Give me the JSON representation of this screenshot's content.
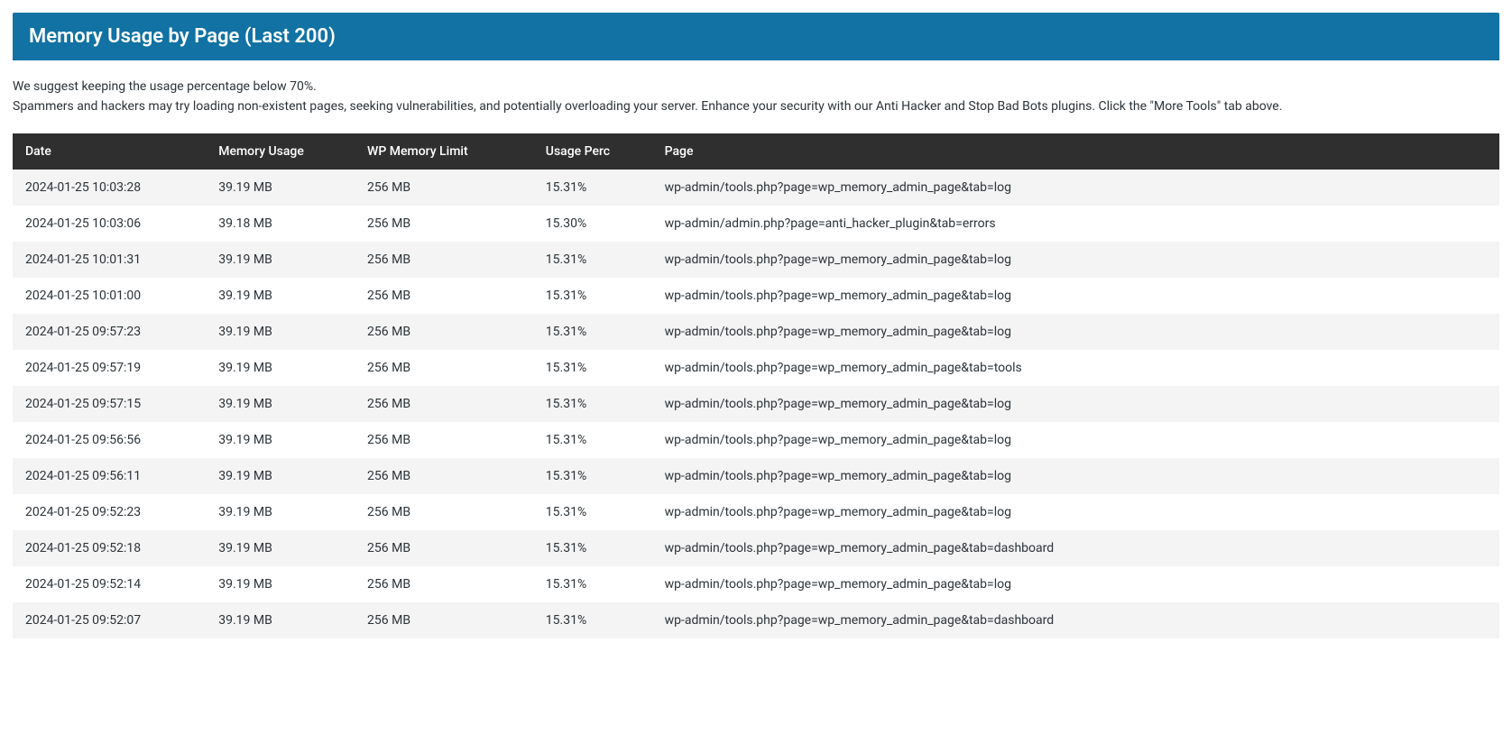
{
  "header": {
    "title": "Memory Usage by Page (Last 200)"
  },
  "description": {
    "line1": "We suggest keeping the usage percentage below 70%.",
    "line2": "Spammers and hackers may try loading non-existent pages, seeking vulnerabilities, and potentially overloading your server. Enhance your security with our Anti Hacker and Stop Bad Bots plugins. Click the \"More Tools\" tab above."
  },
  "table": {
    "columns": {
      "date": "Date",
      "memory": "Memory Usage",
      "limit": "WP Memory Limit",
      "perc": "Usage Perc",
      "page": "Page"
    },
    "rows": [
      {
        "date": "2024-01-25 10:03:28",
        "memory": "39.19 MB",
        "limit": "256 MB",
        "perc": "15.31%",
        "page": "wp-admin/tools.php?page=wp_memory_admin_page&tab=log"
      },
      {
        "date": "2024-01-25 10:03:06",
        "memory": "39.18 MB",
        "limit": "256 MB",
        "perc": "15.30%",
        "page": "wp-admin/admin.php?page=anti_hacker_plugin&tab=errors"
      },
      {
        "date": "2024-01-25 10:01:31",
        "memory": "39.19 MB",
        "limit": "256 MB",
        "perc": "15.31%",
        "page": "wp-admin/tools.php?page=wp_memory_admin_page&tab=log"
      },
      {
        "date": "2024-01-25 10:01:00",
        "memory": "39.19 MB",
        "limit": "256 MB",
        "perc": "15.31%",
        "page": "wp-admin/tools.php?page=wp_memory_admin_page&tab=log"
      },
      {
        "date": "2024-01-25 09:57:23",
        "memory": "39.19 MB",
        "limit": "256 MB",
        "perc": "15.31%",
        "page": "wp-admin/tools.php?page=wp_memory_admin_page&tab=log"
      },
      {
        "date": "2024-01-25 09:57:19",
        "memory": "39.19 MB",
        "limit": "256 MB",
        "perc": "15.31%",
        "page": "wp-admin/tools.php?page=wp_memory_admin_page&tab=tools"
      },
      {
        "date": "2024-01-25 09:57:15",
        "memory": "39.19 MB",
        "limit": "256 MB",
        "perc": "15.31%",
        "page": "wp-admin/tools.php?page=wp_memory_admin_page&tab=log"
      },
      {
        "date": "2024-01-25 09:56:56",
        "memory": "39.19 MB",
        "limit": "256 MB",
        "perc": "15.31%",
        "page": "wp-admin/tools.php?page=wp_memory_admin_page&tab=log"
      },
      {
        "date": "2024-01-25 09:56:11",
        "memory": "39.19 MB",
        "limit": "256 MB",
        "perc": "15.31%",
        "page": "wp-admin/tools.php?page=wp_memory_admin_page&tab=log"
      },
      {
        "date": "2024-01-25 09:52:23",
        "memory": "39.19 MB",
        "limit": "256 MB",
        "perc": "15.31%",
        "page": "wp-admin/tools.php?page=wp_memory_admin_page&tab=log"
      },
      {
        "date": "2024-01-25 09:52:18",
        "memory": "39.19 MB",
        "limit": "256 MB",
        "perc": "15.31%",
        "page": "wp-admin/tools.php?page=wp_memory_admin_page&tab=dashboard"
      },
      {
        "date": "2024-01-25 09:52:14",
        "memory": "39.19 MB",
        "limit": "256 MB",
        "perc": "15.31%",
        "page": "wp-admin/tools.php?page=wp_memory_admin_page&tab=log"
      },
      {
        "date": "2024-01-25 09:52:07",
        "memory": "39.19 MB",
        "limit": "256 MB",
        "perc": "15.31%",
        "page": "wp-admin/tools.php?page=wp_memory_admin_page&tab=dashboard"
      }
    ]
  }
}
